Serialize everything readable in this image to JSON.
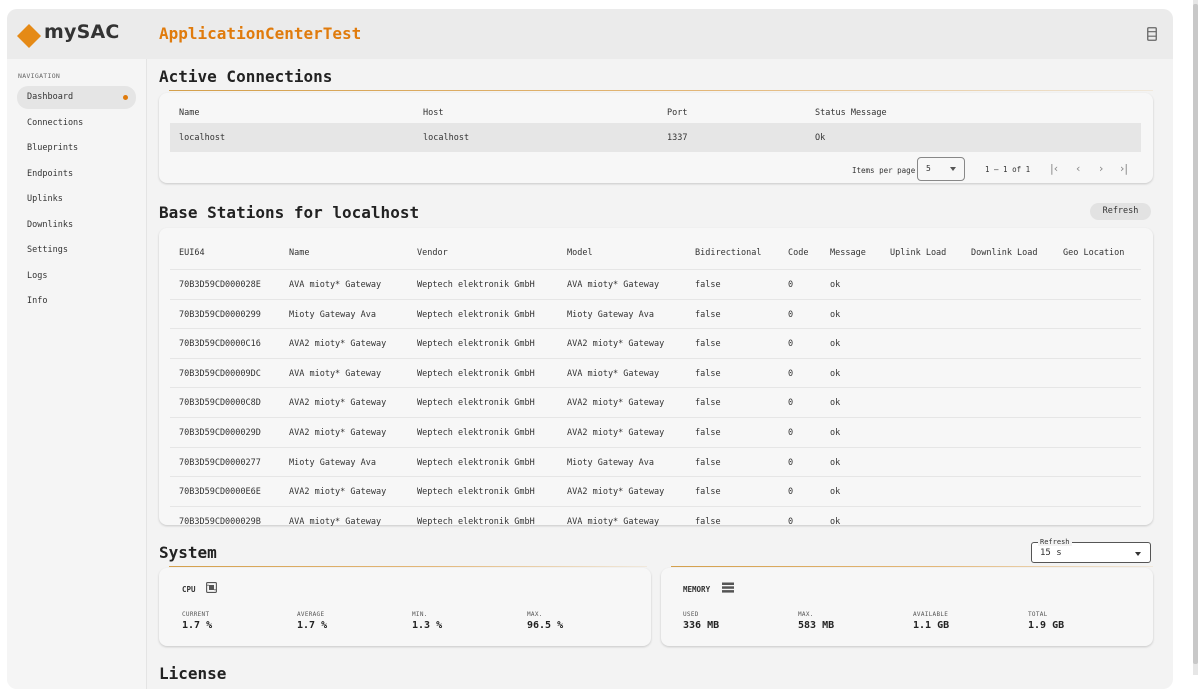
{
  "brand": {
    "name": "mySAC",
    "accent": "#e07b0c"
  },
  "app_title": "ApplicationCenterTest",
  "sidebar": {
    "heading": "NAVIGATION",
    "items": [
      {
        "label": "Dashboard",
        "active": true
      },
      {
        "label": "Connections"
      },
      {
        "label": "Blueprints"
      },
      {
        "label": "Endpoints"
      },
      {
        "label": "Uplinks"
      },
      {
        "label": "Downlinks"
      },
      {
        "label": "Settings"
      },
      {
        "label": "Logs"
      },
      {
        "label": "Info"
      }
    ]
  },
  "active_connections": {
    "title": "Active Connections",
    "columns": [
      "Name",
      "Host",
      "Port",
      "Status Message"
    ],
    "rows": [
      [
        "localhost",
        "localhost",
        "1337",
        "Ok"
      ]
    ],
    "paginator": {
      "items_per_page_label": "Items per page",
      "items_per_page_value": "5",
      "range": "1 – 1 of 1"
    }
  },
  "base_stations": {
    "title": "Base Stations for localhost",
    "refresh_label": "Refresh",
    "columns": [
      "EUI64",
      "Name",
      "Vendor",
      "Model",
      "Bidirectional",
      "Code",
      "Message",
      "Uplink Load",
      "Downlink Load",
      "Geo Location"
    ],
    "rows": [
      [
        "70B3D59CD000028E",
        "AVA mioty* Gateway",
        "Weptech elektronik GmbH",
        "AVA mioty* Gateway",
        "false",
        "0",
        "ok"
      ],
      [
        "70B3D59CD0000299",
        "Mioty Gateway Ava",
        "Weptech elektronik GmbH",
        "Mioty Gateway Ava",
        "false",
        "0",
        "ok"
      ],
      [
        "70B3D59CD0000C16",
        "AVA2 mioty* Gateway",
        "Weptech elektronik GmbH",
        "AVA2 mioty* Gateway",
        "false",
        "0",
        "ok"
      ],
      [
        "70B3D59CD00009DC",
        "AVA mioty* Gateway",
        "Weptech elektronik GmbH",
        "AVA mioty* Gateway",
        "false",
        "0",
        "ok"
      ],
      [
        "70B3D59CD0000C8D",
        "AVA2 mioty* Gateway",
        "Weptech elektronik GmbH",
        "AVA2 mioty* Gateway",
        "false",
        "0",
        "ok"
      ],
      [
        "70B3D59CD000029D",
        "AVA2 mioty* Gateway",
        "Weptech elektronik GmbH",
        "AVA2 mioty* Gateway",
        "false",
        "0",
        "ok"
      ],
      [
        "70B3D59CD0000277",
        "Mioty Gateway Ava",
        "Weptech elektronik GmbH",
        "Mioty Gateway Ava",
        "false",
        "0",
        "ok"
      ],
      [
        "70B3D59CD0000E6E",
        "AVA2 mioty* Gateway",
        "Weptech elektronik GmbH",
        "AVA2 mioty* Gateway",
        "false",
        "0",
        "ok"
      ],
      [
        "70B3D59CD000029B",
        "AVA mioty* Gateway",
        "Weptech elektronik GmbH",
        "AVA mioty* Gateway",
        "false",
        "0",
        "ok"
      ]
    ]
  },
  "system": {
    "title": "System",
    "refresh_legend": "Refresh",
    "refresh_value": "15 s",
    "cpu": {
      "heading": "CPU",
      "metrics": [
        {
          "label": "CURRENT",
          "value": "1.7 %"
        },
        {
          "label": "AVERAGE",
          "value": "1.7 %"
        },
        {
          "label": "MIN.",
          "value": "1.3 %"
        },
        {
          "label": "MAX.",
          "value": "96.5 %"
        }
      ]
    },
    "memory": {
      "heading": "MEMORY",
      "metrics": [
        {
          "label": "USED",
          "value": "336 MB"
        },
        {
          "label": "MAX.",
          "value": "583 MB"
        },
        {
          "label": "AVAILABLE",
          "value": "1.1 GB"
        },
        {
          "label": "TOTAL",
          "value": "1.9 GB"
        }
      ]
    }
  },
  "license": {
    "title": "License"
  }
}
